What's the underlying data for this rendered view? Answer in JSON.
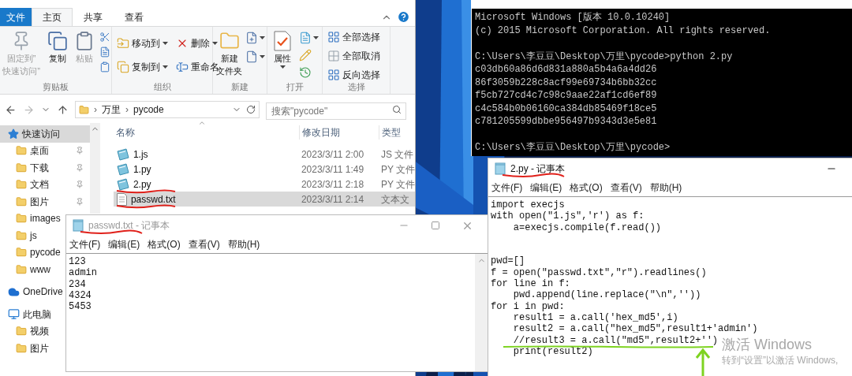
{
  "explorer": {
    "ribbon_tabs": [
      {
        "label": "文件",
        "kind": "file",
        "selected": false
      },
      {
        "label": "主页",
        "kind": "tab",
        "selected": true
      },
      {
        "label": "共享",
        "kind": "tab",
        "selected": false
      },
      {
        "label": "查看",
        "kind": "tab",
        "selected": false
      }
    ],
    "ribbon_groups": [
      {
        "label": "剪贴板",
        "items": [
          {
            "lines": [
              "固定到”",
              "快速访问”"
            ],
            "disabled": true
          },
          {
            "lines": [
              "复制"
            ],
            "disabled": false
          },
          {
            "lines": [
              "粘贴"
            ],
            "disabled": true
          }
        ]
      },
      {
        "label": "组织",
        "items": [
          {
            "lines": [
              "移动到"
            ],
            "dropdown": true
          },
          {
            "lines": [
              "删除"
            ],
            "dropdown": true
          },
          {
            "lines": [
              "复制到"
            ],
            "dropdown": true
          },
          {
            "lines": [
              "重命名"
            ],
            "dropdown": false
          }
        ]
      },
      {
        "label": "新建",
        "items": [
          {
            "lines": [
              "新建",
              "文件夹"
            ]
          }
        ]
      },
      {
        "label": "打开",
        "items": [
          {
            "lines": [
              "属性"
            ],
            "dropdown": true
          }
        ]
      },
      {
        "label": "选择",
        "items": [
          {
            "lines": [
              "全部选择"
            ]
          },
          {
            "lines": [
              "全部取消"
            ]
          },
          {
            "lines": [
              "反向选择"
            ]
          }
        ]
      }
    ],
    "address": {
      "path": [
        {
          "separator": "›",
          "label": "万里"
        },
        {
          "separator": "›",
          "label": "pycode"
        }
      ]
    },
    "search": {
      "placeholder": "搜索\"pycode\""
    },
    "nav": [
      {
        "label": "快速访问",
        "kind": "quick_access",
        "selected": true,
        "pinned": false,
        "children": [
          {
            "label": "桌面",
            "kind": "folder",
            "selected": false,
            "pinned": true
          },
          {
            "label": "下载",
            "kind": "folder",
            "selected": false,
            "pinned": true
          },
          {
            "label": "文档",
            "kind": "folder",
            "selected": false,
            "pinned": true
          },
          {
            "label": "图片",
            "kind": "folder",
            "selected": false,
            "pinned": true
          },
          {
            "label": "images",
            "kind": "folder",
            "selected": false,
            "pinned": false
          },
          {
            "label": "js",
            "kind": "folder",
            "selected": false,
            "pinned": false
          },
          {
            "label": "pycode",
            "kind": "folder",
            "selected": false,
            "pinned": false
          },
          {
            "label": "www",
            "kind": "folder",
            "selected": false,
            "pinned": false
          }
        ]
      },
      {
        "label": "OneDrive",
        "kind": "cloud",
        "selected": false,
        "pinned": false
      },
      {
        "label": "此电脑",
        "kind": "computer",
        "selected": false,
        "pinned": false,
        "children": [
          {
            "label": "视频",
            "kind": "folder",
            "selected": false,
            "pinned": false
          },
          {
            "label": "图片",
            "kind": "folder",
            "selected": false,
            "pinned": false
          }
        ]
      }
    ],
    "columns": [
      "名称",
      "修改日期",
      "类型"
    ],
    "files": [
      {
        "name": "1.js",
        "date": "2023/3/11 2:00",
        "type": "JS 文件",
        "kind": "script",
        "selected": false,
        "underlined": false
      },
      {
        "name": "1.py",
        "date": "2023/3/11 1:49",
        "type": "PY 文件",
        "kind": "script",
        "selected": false,
        "underlined": false
      },
      {
        "name": "2.py",
        "date": "2023/3/11 2:18",
        "type": "PY 文件",
        "kind": "script",
        "selected": false,
        "underlined": true
      },
      {
        "name": "passwd.txt",
        "date": "2023/3/11 2:14",
        "type": "文本文",
        "kind": "text",
        "selected": true,
        "underlined": true
      }
    ]
  },
  "cmd": {
    "blocks": [
      [
        "Microsoft Windows [版本 10.0.10240]",
        "(c) 2015 Microsoft Corporation. All rights reserved."
      ],
      [
        "C:\\Users\\李豆豆\\Desktop\\万里\\pycode>python 2.py",
        "c03db60a86d6d831a880a5b4a6a4dd26",
        "86f3059b228c8acf99e69734b6bb32cc",
        "f5cb727cd4c7c98c9aae22af1cd6ef89",
        "c4c584b0b06160ca384db85469f18ce5",
        "c781205599dbbe956497b9343d3e5e81"
      ],
      [
        "C:\\Users\\李豆豆\\Desktop\\万里\\pycode>"
      ]
    ]
  },
  "notepads": [
    {
      "title": "passwd.txt - 记事本",
      "active": false,
      "underlined": true,
      "menu": [
        "文件(F)",
        "编辑(E)",
        "格式(O)",
        "查看(V)",
        "帮助(H)"
      ],
      "blocks": [
        [
          "123",
          "admin",
          "234",
          "4324",
          "5453"
        ]
      ]
    },
    {
      "title": "2.py - 记事本",
      "active": true,
      "underlined": true,
      "menu": [
        "文件(F)",
        "编辑(E)",
        "格式(O)",
        "查看(V)",
        "帮助(H)"
      ],
      "blocks": [
        [
          "import execjs",
          "with open(\"1.js\",'r') as f:",
          "    a=execjs.compile(f.read())"
        ],
        [
          "pwd=[]",
          "f = open(\"passwd.txt\",\"r\").readlines()",
          "for line in f:",
          "    pwd.append(line.replace(\"\\n\",''))",
          "for i in pwd:",
          "    result1 = a.call('hex_md5',i)",
          "    result2 = a.call(\"hex_md5\",result1+'admin')",
          "    //result3 = a.call(\"md5\",result2+'')",
          "    print(result2)"
        ]
      ]
    }
  ],
  "activation": {
    "title": "激活 Windows",
    "hint": "转到“设置”以激活 Windows,"
  }
}
